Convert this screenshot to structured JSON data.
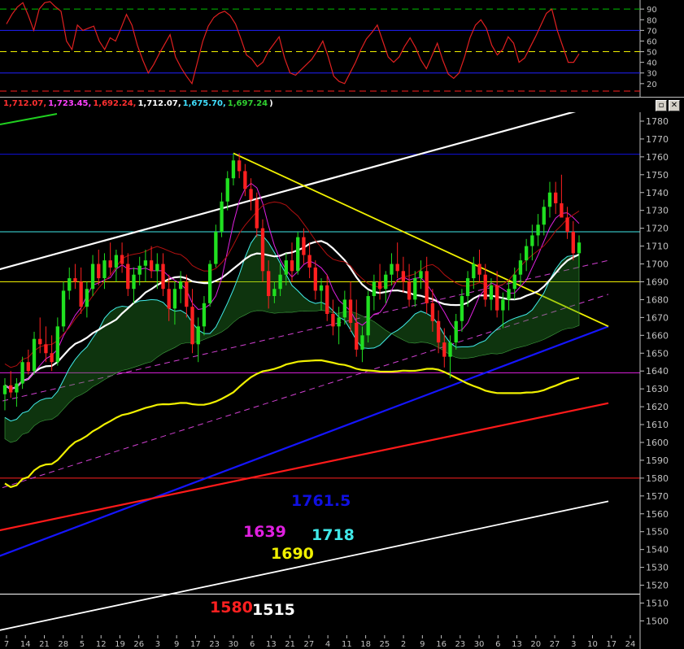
{
  "window": {
    "ohlc_values": [
      {
        "text": "1,712.07,",
        "color": "#ff3030"
      },
      {
        "text": "1,723.45,",
        "color": "#ff40ff"
      },
      {
        "text": "1,692.24,",
        "color": "#ff3030"
      },
      {
        "text": "1,712.07,",
        "color": "#ffffff"
      },
      {
        "text": "1,675.70,",
        "color": "#40e0ff"
      },
      {
        "text": "1,697.24",
        "color": "#30d030"
      },
      {
        "text": ")",
        "color": "#ffffff"
      }
    ],
    "restore_icon": "restore-icon",
    "close_icon": "close-icon"
  },
  "annotations": [
    {
      "text": "1761.5",
      "color": "#1010e0"
    },
    {
      "text": "1639",
      "color": "#e020e0"
    },
    {
      "text": "1718",
      "color": "#40e8e8"
    },
    {
      "text": "1690",
      "color": "#f0f000"
    },
    {
      "text": "1580",
      "color": "#ff2020"
    },
    {
      "text": "1515",
      "color": "#ffffff"
    }
  ],
  "chart_data": [
    {
      "type": "line",
      "panel": "oscillator",
      "y_ticks": [
        90,
        80,
        70,
        60,
        50,
        40,
        30,
        20
      ],
      "ylim": [
        13,
        97
      ],
      "reference_lines": [
        {
          "value": 90,
          "color": "#00c000",
          "style": "dashed"
        },
        {
          "value": 70,
          "color": "#2020ff",
          "style": "solid"
        },
        {
          "value": 50,
          "color": "#f0f000",
          "style": "dashed"
        },
        {
          "value": 30,
          "color": "#2020ff",
          "style": "solid"
        },
        {
          "value": 13,
          "color": "#ff2020",
          "style": "dashed"
        }
      ],
      "series": [
        {
          "color": "#e02020",
          "values": [
            76,
            85,
            92,
            96,
            84,
            70,
            90,
            96,
            97,
            92,
            88,
            60,
            52,
            75,
            70,
            72,
            74,
            60,
            52,
            63,
            60,
            72,
            85,
            75,
            56,
            42,
            30,
            38,
            48,
            57,
            66,
            45,
            35,
            27,
            20,
            40,
            60,
            74,
            82,
            86,
            88,
            84,
            76,
            62,
            47,
            43,
            36,
            40,
            50,
            57,
            64,
            44,
            30,
            28,
            33,
            38,
            43,
            51,
            60,
            45,
            27,
            22,
            20,
            30,
            40,
            52,
            62,
            68,
            75,
            60,
            45,
            40,
            45,
            55,
            63,
            54,
            42,
            34,
            46,
            58,
            42,
            29,
            25,
            30,
            45,
            63,
            75,
            80,
            72,
            56,
            47,
            52,
            64,
            58,
            40,
            44,
            54,
            64,
            75,
            86,
            90,
            70,
            55,
            40,
            40,
            48
          ]
        }
      ]
    },
    {
      "type": "candlestick",
      "panel": "price",
      "y_ticks": [
        1780,
        1770,
        1760,
        1750,
        1740,
        1730,
        1720,
        1710,
        1700,
        1690,
        1680,
        1670,
        1660,
        1650,
        1640,
        1630,
        1620,
        1610,
        1600,
        1590,
        1580,
        1570,
        1560,
        1550,
        1540,
        1530,
        1520,
        1510,
        1500
      ],
      "ylim": [
        1492,
        1785
      ],
      "x_tick_labels": [
        "7",
        "14",
        "21",
        "28",
        "5",
        "12",
        "19",
        "26",
        "3",
        "9",
        "17",
        "23",
        "30",
        "6",
        "13",
        "21",
        "27",
        "4",
        "11",
        "18",
        "25",
        "2",
        "9",
        "16",
        "23",
        "30",
        "6",
        "13",
        "20",
        "27",
        "3",
        "10",
        "17",
        "24"
      ],
      "candles": [
        [
          1627,
          1636,
          1618,
          1632
        ],
        [
          1632,
          1640,
          1625,
          1628
        ],
        [
          1628,
          1636,
          1620,
          1633
        ],
        [
          1633,
          1648,
          1630,
          1645
        ],
        [
          1645,
          1652,
          1638,
          1640
        ],
        [
          1640,
          1662,
          1638,
          1658
        ],
        [
          1658,
          1670,
          1650,
          1655
        ],
        [
          1655,
          1665,
          1645,
          1650
        ],
        [
          1650,
          1660,
          1640,
          1645
        ],
        [
          1645,
          1670,
          1643,
          1665
        ],
        [
          1665,
          1690,
          1662,
          1685
        ],
        [
          1685,
          1698,
          1680,
          1692
        ],
        [
          1692,
          1700,
          1686,
          1690
        ],
        [
          1690,
          1698,
          1672,
          1676
        ],
        [
          1676,
          1690,
          1670,
          1686
        ],
        [
          1686,
          1705,
          1682,
          1700
        ],
        [
          1700,
          1708,
          1688,
          1692
        ],
        [
          1692,
          1706,
          1686,
          1702
        ],
        [
          1702,
          1712,
          1694,
          1698
        ],
        [
          1698,
          1708,
          1690,
          1705
        ],
        [
          1705,
          1712,
          1695,
          1700
        ],
        [
          1700,
          1706,
          1682,
          1686
        ],
        [
          1686,
          1698,
          1678,
          1694
        ],
        [
          1694,
          1704,
          1688,
          1699
        ],
        [
          1699,
          1708,
          1690,
          1702
        ],
        [
          1702,
          1710,
          1692,
          1696
        ],
        [
          1696,
          1706,
          1686,
          1700
        ],
        [
          1700,
          1706,
          1682,
          1686
        ],
        [
          1686,
          1694,
          1668,
          1675
        ],
        [
          1675,
          1690,
          1666,
          1686
        ],
        [
          1686,
          1696,
          1678,
          1690
        ],
        [
          1690,
          1694,
          1670,
          1676
        ],
        [
          1676,
          1686,
          1650,
          1655
        ],
        [
          1655,
          1670,
          1645,
          1665
        ],
        [
          1665,
          1682,
          1660,
          1678
        ],
        [
          1678,
          1702,
          1676,
          1700
        ],
        [
          1700,
          1722,
          1698,
          1718
        ],
        [
          1718,
          1740,
          1715,
          1735
        ],
        [
          1735,
          1752,
          1730,
          1748
        ],
        [
          1748,
          1762,
          1744,
          1758
        ],
        [
          1758,
          1762,
          1748,
          1752
        ],
        [
          1752,
          1756,
          1738,
          1742
        ],
        [
          1742,
          1748,
          1730,
          1736
        ],
        [
          1736,
          1740,
          1715,
          1720
        ],
        [
          1720,
          1725,
          1690,
          1696
        ],
        [
          1696,
          1702,
          1675,
          1682
        ],
        [
          1682,
          1690,
          1678,
          1686
        ],
        [
          1686,
          1700,
          1682,
          1694
        ],
        [
          1694,
          1706,
          1688,
          1702
        ],
        [
          1702,
          1712,
          1690,
          1696
        ],
        [
          1696,
          1718,
          1694,
          1715
        ],
        [
          1715,
          1720,
          1700,
          1705
        ],
        [
          1705,
          1712,
          1692,
          1698
        ],
        [
          1698,
          1702,
          1680,
          1685
        ],
        [
          1685,
          1692,
          1674,
          1688
        ],
        [
          1688,
          1694,
          1668,
          1672
        ],
        [
          1672,
          1680,
          1660,
          1665
        ],
        [
          1665,
          1676,
          1655,
          1670
        ],
        [
          1670,
          1685,
          1666,
          1680
        ],
        [
          1680,
          1690,
          1662,
          1667
        ],
        [
          1667,
          1680,
          1648,
          1652
        ],
        [
          1652,
          1665,
          1645,
          1660
        ],
        [
          1660,
          1685,
          1656,
          1682
        ],
        [
          1682,
          1694,
          1674,
          1690
        ],
        [
          1690,
          1700,
          1680,
          1686
        ],
        [
          1686,
          1696,
          1678,
          1694
        ],
        [
          1694,
          1706,
          1688,
          1700
        ],
        [
          1700,
          1712,
          1692,
          1696
        ],
        [
          1696,
          1704,
          1684,
          1690
        ],
        [
          1690,
          1700,
          1676,
          1680
        ],
        [
          1680,
          1696,
          1676,
          1692
        ],
        [
          1692,
          1702,
          1686,
          1696
        ],
        [
          1696,
          1704,
          1672,
          1678
        ],
        [
          1678,
          1686,
          1662,
          1668
        ],
        [
          1668,
          1674,
          1650,
          1656
        ],
        [
          1656,
          1664,
          1642,
          1648
        ],
        [
          1648,
          1660,
          1636,
          1656
        ],
        [
          1656,
          1672,
          1652,
          1668
        ],
        [
          1668,
          1686,
          1662,
          1682
        ],
        [
          1682,
          1696,
          1676,
          1692
        ],
        [
          1692,
          1704,
          1686,
          1700
        ],
        [
          1700,
          1708,
          1690,
          1694
        ],
        [
          1694,
          1700,
          1676,
          1680
        ],
        [
          1680,
          1692,
          1674,
          1688
        ],
        [
          1688,
          1696,
          1670,
          1674
        ],
        [
          1674,
          1684,
          1664,
          1680
        ],
        [
          1680,
          1690,
          1674,
          1686
        ],
        [
          1686,
          1698,
          1680,
          1694
        ],
        [
          1694,
          1706,
          1688,
          1702
        ],
        [
          1702,
          1714,
          1696,
          1710
        ],
        [
          1710,
          1722,
          1702,
          1716
        ],
        [
          1716,
          1728,
          1710,
          1722
        ],
        [
          1722,
          1736,
          1716,
          1732
        ],
        [
          1732,
          1746,
          1726,
          1740
        ],
        [
          1740,
          1746,
          1728,
          1734
        ],
        [
          1734,
          1750,
          1730,
          1726
        ],
        [
          1726,
          1732,
          1714,
          1718
        ],
        [
          1718,
          1724,
          1702,
          1706
        ],
        [
          1706,
          1716,
          1698,
          1712
        ]
      ],
      "horizontal_lines": [
        {
          "value": 1761.5,
          "color": "#1010e0"
        },
        {
          "value": 1718,
          "color": "#40e8e8"
        },
        {
          "value": 1690,
          "color": "#f0f000"
        },
        {
          "value": 1639,
          "color": "#e020e0"
        },
        {
          "value": 1580,
          "color": "#ff2020"
        },
        {
          "value": 1515,
          "color": "#ffffff"
        }
      ]
    }
  ]
}
